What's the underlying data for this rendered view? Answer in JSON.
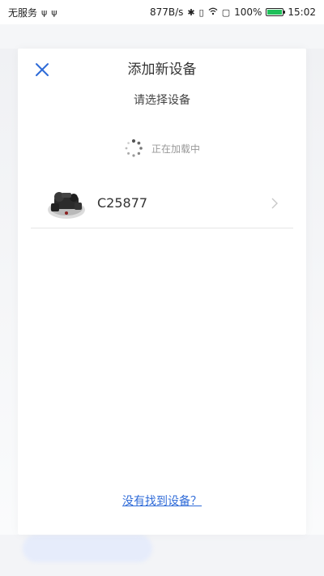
{
  "status_bar": {
    "carrier": "无服务",
    "network_speed": "877B/s",
    "battery_percent": "100%",
    "time": "15:02",
    "icons": [
      "usb-icon",
      "usb-icon",
      "bluetooth-icon",
      "vibrate-icon",
      "wifi-icon",
      "sim-icon",
      "battery-icon"
    ],
    "battery_level": 1.0
  },
  "dialog": {
    "title": "添加新设备",
    "subtitle": "请选择设备",
    "close_icon": "close-icon",
    "loading_text": "正在加载中",
    "devices": [
      {
        "name": "C25877",
        "icon": "device-image"
      }
    ],
    "not_found_link": "没有找到设备？"
  },
  "colors": {
    "accent": "#2f6bd8",
    "battery_green": "#1fc05a",
    "text_primary": "#333333",
    "text_muted": "#999999"
  }
}
